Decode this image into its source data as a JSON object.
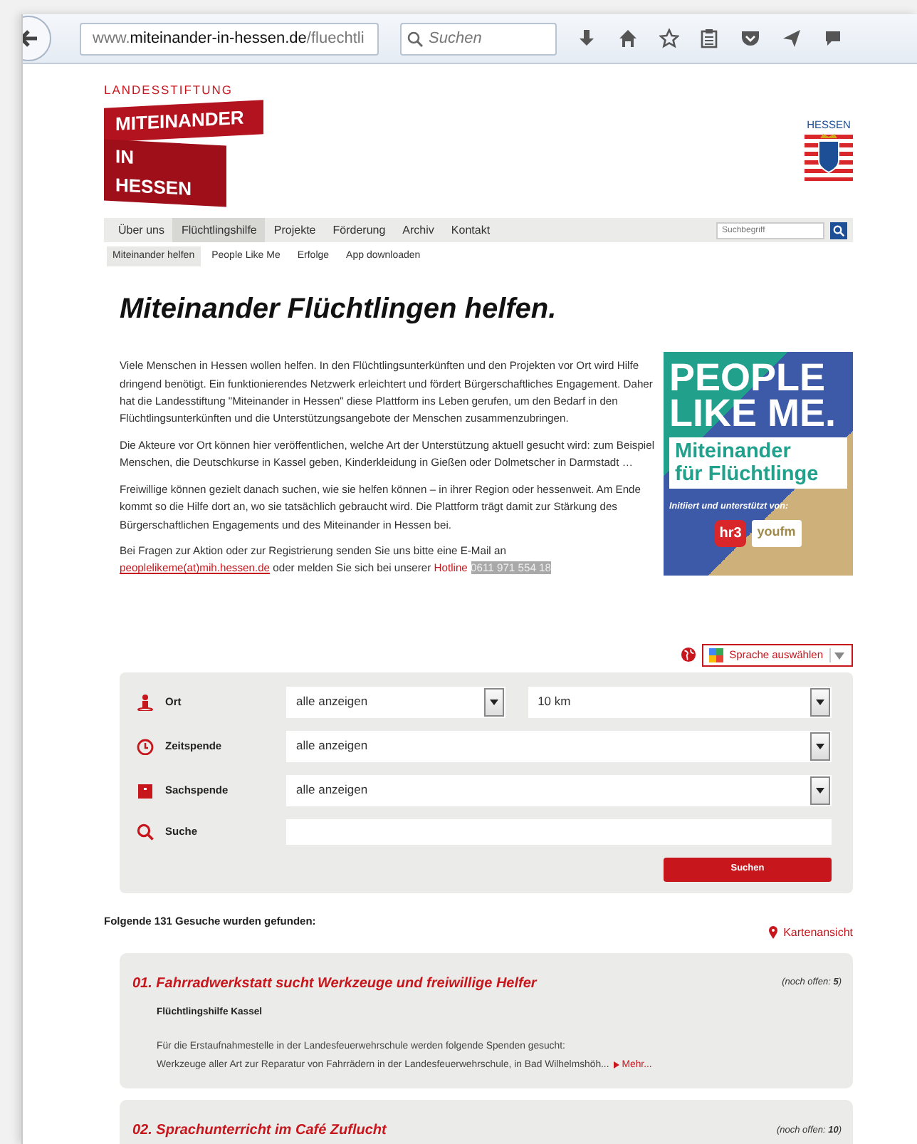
{
  "browser": {
    "url_prefix": "www.",
    "url_domain": "miteinander-in-hessen.de",
    "url_path": "/fluechtli",
    "search_placeholder": "Suchen"
  },
  "header": {
    "foundation_label": "LANDESSTIFTUNG",
    "logo_line_1": "MITEINANDER",
    "logo_line_2": "IN HESSEN",
    "state_logo_text": "HESSEN"
  },
  "nav": {
    "items": [
      {
        "label": "Über uns",
        "selected": false
      },
      {
        "label": "Flüchtlingshilfe",
        "selected": true
      },
      {
        "label": "Projekte",
        "selected": false
      },
      {
        "label": "Förderung",
        "selected": false
      },
      {
        "label": "Archiv",
        "selected": false
      },
      {
        "label": "Kontakt",
        "selected": false
      }
    ],
    "search_placeholder": "Suchbegriff"
  },
  "subnav": [
    {
      "label": "Miteinander helfen",
      "selected": true
    },
    {
      "label": "People Like Me",
      "selected": false
    },
    {
      "label": "Erfolge",
      "selected": false
    },
    {
      "label": "App downloaden",
      "selected": false
    }
  ],
  "heading": "Miteinander Flüchtlingen helfen.",
  "paragraphs": [
    "Viele Menschen in Hessen wollen helfen. In den Flüchtlingsunterkünften und den Projekten vor Ort wird Hilfe dringend benötigt. Ein funktionierendes Netzwerk erleichtert und fördert Bürgerschaftliches Engagement. Daher hat die Landesstiftung \"Miteinander in Hessen\" diese Plattform ins Leben gerufen, um den Bedarf in den Flüchtlingsunterkünften und die Unterstützungsangebote der Menschen zusammenzubringen.",
    "Die Akteure vor Ort können hier veröffentlichen, welche Art der Unterstützung aktuell gesucht wird: zum Beispiel Menschen, die Deutschkurse in Kassel geben, Kinderkleidung in Gießen oder Dolmetscher in Darmstadt …",
    "Freiwillige können gezielt danach suchen, wie sie helfen können – in ihrer Region oder hessenweit. Am Ende kommt so die Hilfe dort an, wo sie tatsächlich gebraucht wird. Die Plattform trägt damit zur Stärkung des Bürgerschaftlichen Engagements und des Miteinander in Hessen bei."
  ],
  "contact": [
    {
      "kind": "text",
      "text": "Bei Fragen zur Aktion oder zur Registrierung senden Sie uns bitte eine E-Mail an "
    },
    {
      "kind": "link",
      "text": "peoplelikeme(at)mih.hessen.de"
    },
    {
      "kind": "text",
      "text": " oder melden Sie sich bei unserer "
    },
    {
      "kind": "hotline",
      "text": "Hotline"
    },
    {
      "kind": "phone",
      "text": "0611 971 554 18"
    }
  ],
  "banner": {
    "line_1": "PEOPLE",
    "line_2": "LIKE ME.",
    "subtitle_1": "Miteinander",
    "subtitle_2": "für Flüchtlinge",
    "credit": "Initiiert und unterstützt von:",
    "partner_1": "hr3",
    "partner_2": "youfm"
  },
  "language_select": {
    "label": "Sprache auswählen"
  },
  "filters": [
    {
      "kind": "double_select",
      "label": "Ort",
      "value": "alle anzeigen",
      "value_2": "10 km"
    },
    {
      "kind": "select",
      "label": "Zeitspende",
      "value": "alle anzeigen"
    },
    {
      "kind": "select",
      "label": "Sachspende",
      "value": "alle anzeigen"
    },
    {
      "kind": "text",
      "label": "Suche"
    }
  ],
  "search_button": "Suchen",
  "results": {
    "summary": "Folgende 131 Gesuche wurden gefunden:",
    "map_link": "Kartenansicht",
    "items": [
      {
        "title": "01. Fahrradwerkstatt sucht Werkzeuge und freiwillige Helfer",
        "open": "(noch offen: **5**)",
        "organization": "Flüchtlingshilfe Kassel",
        "description": [
          "Für die Erstaufnahmestelle in der Landesfeuerwehrschule werden folgende Spenden gesucht:",
          "Werkzeuge aller Art zur Reparatur von Fahrrädern in der Landesfeuerwehrschule, in Bad Wilhelmshöh..."
        ],
        "more": "Mehr..."
      },
      {
        "title": "02. Sprachunterricht im Café Zuflucht",
        "open": "(noch offen: **10**)"
      }
    ]
  }
}
